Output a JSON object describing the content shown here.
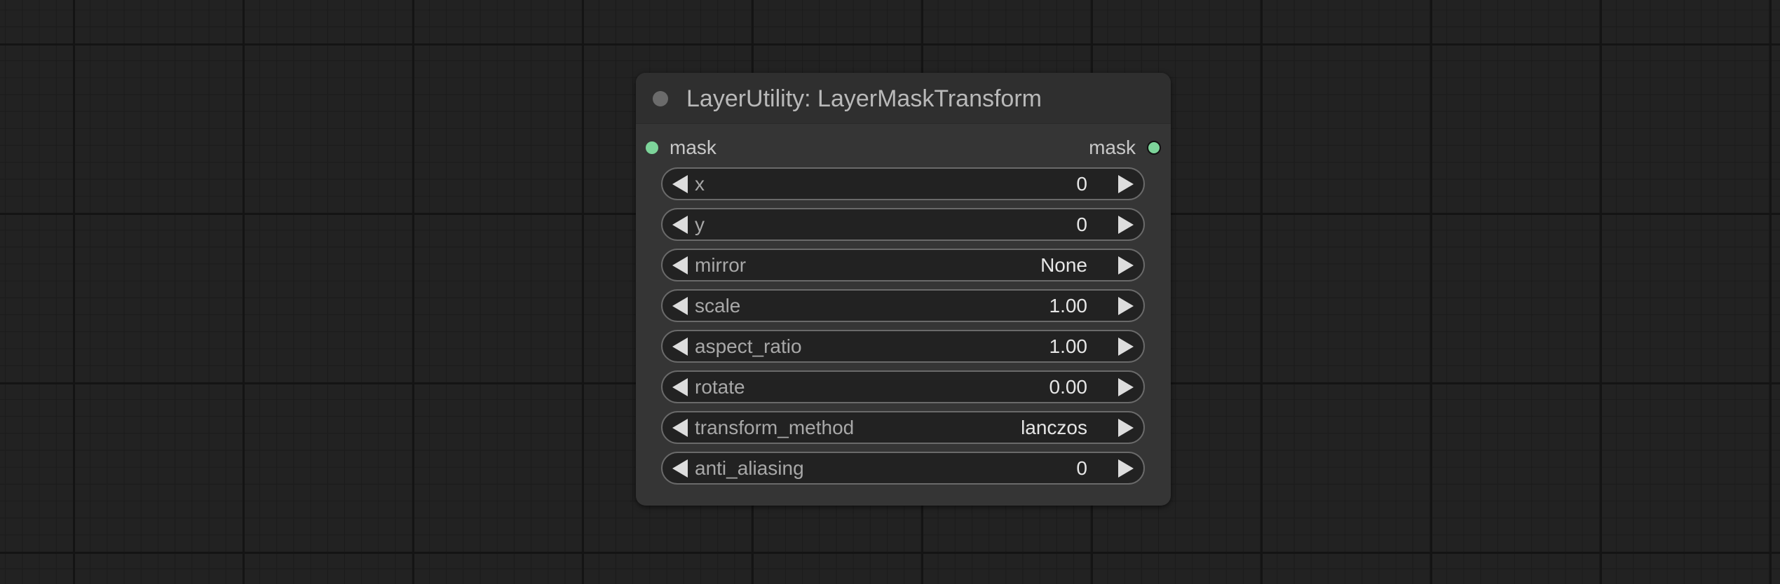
{
  "node": {
    "title": "LayerUtility: LayerMaskTransform",
    "input_label": "mask",
    "output_label": "mask",
    "widgets": [
      {
        "label": "x",
        "value": "0"
      },
      {
        "label": "y",
        "value": "0"
      },
      {
        "label": "mirror",
        "value": "None"
      },
      {
        "label": "scale",
        "value": "1.00"
      },
      {
        "label": "aspect_ratio",
        "value": "1.00"
      },
      {
        "label": "rotate",
        "value": "0.00"
      },
      {
        "label": "transform_method",
        "value": "lanczos"
      },
      {
        "label": "anti_aliasing",
        "value": "0"
      }
    ]
  },
  "colors": {
    "canvas_bg": "#222222",
    "node_bg": "#353535",
    "slot_color": "#7dd49a",
    "widget_bg": "#222222",
    "widget_border": "#6a6a6a"
  },
  "icons": {
    "collapse": "circle-dot-icon",
    "decrement": "triangle-left-icon",
    "increment": "triangle-right-icon"
  }
}
